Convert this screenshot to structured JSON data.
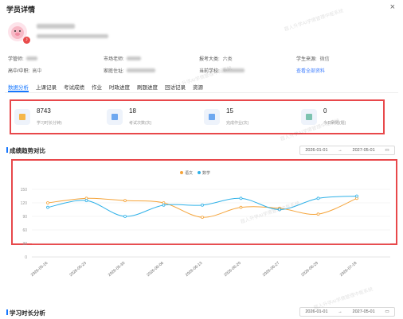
{
  "header": {
    "title": "学员详情",
    "close": "×"
  },
  "profile": {
    "fields": [
      {
        "label": "学管师:",
        "value": ""
      },
      {
        "label": "市场老师:",
        "value": ""
      },
      {
        "label": "报考大类:",
        "value": "六类"
      },
      {
        "label": "学生来源:",
        "value": "微信"
      },
      {
        "label": "高中/中职:",
        "value": "高中"
      },
      {
        "label": "家庭住址:",
        "value": ""
      },
      {
        "label": "当前学校:",
        "value": ""
      },
      {
        "label": "",
        "value": "查看全部资料"
      }
    ]
  },
  "tabs": [
    "数据分析",
    "上课记录",
    "考试成绩",
    "作业",
    "时政进度",
    "刷题进度",
    "回访记录",
    "资源"
  ],
  "stats": [
    {
      "value": "8743",
      "label": "学习时长分钟)",
      "color": "#f5b74a"
    },
    {
      "value": "18",
      "label": "考试次数(次)",
      "color": "#6ea8f0"
    },
    {
      "value": "15",
      "label": "完成作业(次)",
      "color": "#6ea8f0"
    },
    {
      "value": "0",
      "label": "今日刷题(题)",
      "color": "#7cc3b0"
    }
  ],
  "trend": {
    "title": "成绩趋势对比",
    "range_start": "2026-01-01",
    "range_sep": "→",
    "range_end": "2027-05-01"
  },
  "study": {
    "title": "学习时长分析",
    "range_start": "2026-01-01",
    "range_sep": "→",
    "range_end": "2027-05-01"
  },
  "watermark": "题人升学AI学情管理中枢系统",
  "chart_data": {
    "type": "line",
    "categories": [
      "2026-05-16",
      "2026-05-23",
      "2026-05-30",
      "2026-06-06",
      "2026-06-13",
      "2026-06-20",
      "2026-06-27",
      "2026-06-29",
      "2026-07-18"
    ],
    "series": [
      {
        "name": "语文",
        "color": "#f5a43a",
        "values": [
          120,
          130,
          125,
          120,
          88,
          110,
          108,
          95,
          130
        ]
      },
      {
        "name": "数学",
        "color": "#2fb1e8",
        "values": [
          110,
          125,
          90,
          115,
          115,
          130,
          105,
          130,
          135
        ]
      }
    ],
    "yticks": [
      0,
      30,
      60,
      90,
      120,
      150
    ],
    "ylim": [
      0,
      150
    ]
  }
}
